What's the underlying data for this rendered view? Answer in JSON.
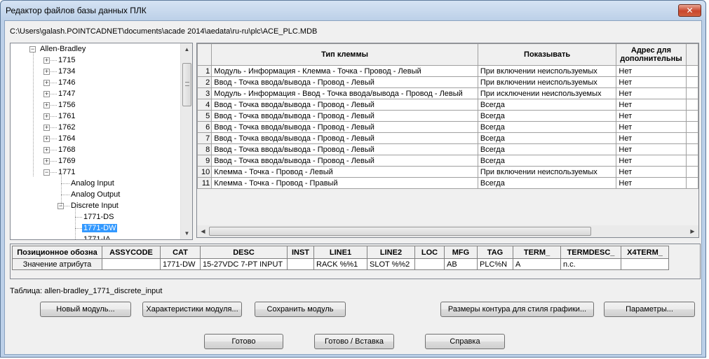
{
  "window": {
    "title": "Редактор файлов базы данных ПЛК",
    "close_label": "✕"
  },
  "path": "C:\\Users\\galash.POINTCADNET\\documents\\acade 2014\\aedata\\ru-ru\\plc\\ACE_PLC.MDB",
  "tree": {
    "root": "Allen-Bradley",
    "items": [
      {
        "label": "1715",
        "toggle": "+"
      },
      {
        "label": "1734",
        "toggle": "+"
      },
      {
        "label": "1746",
        "toggle": "+"
      },
      {
        "label": "1747",
        "toggle": "+"
      },
      {
        "label": "1756",
        "toggle": "+"
      },
      {
        "label": "1761",
        "toggle": "+"
      },
      {
        "label": "1762",
        "toggle": "+"
      },
      {
        "label": "1764",
        "toggle": "+"
      },
      {
        "label": "1768",
        "toggle": "+"
      },
      {
        "label": "1769",
        "toggle": "+"
      },
      {
        "label": "1771",
        "toggle": "−"
      }
    ],
    "sub": [
      "Analog Input",
      "Analog Output",
      "Discrete Input"
    ],
    "leaves": [
      "1771-DS",
      "1771-DW",
      "1771-IA"
    ],
    "selected": "1771-DW"
  },
  "grid": {
    "headers": [
      "Тип клеммы",
      "Показывать",
      "Адрес для дополнительны"
    ],
    "rows": [
      [
        "1",
        "Модуль - Информация - Клемма - Точка - Провод - Левый",
        "При включении неиспользуемых",
        "Нет"
      ],
      [
        "2",
        "Ввод - Точка ввода/вывода - Провод - Левый",
        "При включении неиспользуемых",
        "Нет"
      ],
      [
        "3",
        "Модуль - Информация - Ввод - Точка ввода/вывода - Провод - Левый",
        "При исключении неиспользуемых",
        "Нет"
      ],
      [
        "4",
        "Ввод - Точка ввода/вывода - Провод - Левый",
        "Всегда",
        "Нет"
      ],
      [
        "5",
        "Ввод - Точка ввода/вывода - Провод - Левый",
        "Всегда",
        "Нет"
      ],
      [
        "6",
        "Ввод - Точка ввода/вывода - Провод - Левый",
        "Всегда",
        "Нет"
      ],
      [
        "7",
        "Ввод - Точка ввода/вывода - Провод - Левый",
        "Всегда",
        "Нет"
      ],
      [
        "8",
        "Ввод - Точка ввода/вывода - Провод - Левый",
        "Всегда",
        "Нет"
      ],
      [
        "9",
        "Ввод - Точка ввода/вывода - Провод - Левый",
        "Всегда",
        "Нет"
      ],
      [
        "10",
        "Клемма - Точка - Провод - Левый",
        "При включении неиспользуемых",
        "Нет"
      ],
      [
        "11",
        "Клемма - Точка - Провод - Правый",
        "Всегда",
        "Нет"
      ]
    ]
  },
  "attributes": {
    "headers": [
      "Позиционное обозна",
      "ASSYCODE",
      "CAT",
      "DESC",
      "INST",
      "LINE1",
      "LINE2",
      "LOC",
      "MFG",
      "TAG",
      "TERM_",
      "TERMDESC_",
      "X4TERM_"
    ],
    "values": [
      "Значение атрибута",
      "",
      "1771-DW",
      "15-27VDC 7-PT INPUT",
      "",
      "RACK %%1",
      "SLOT %%2",
      "",
      "AB",
      "PLC%N",
      "A",
      "n.c.",
      ""
    ]
  },
  "table_name": "Таблица: allen-bradley_1771_discrete_input",
  "buttons": {
    "new_module": "Новый модуль...",
    "module_props": "Характеристики модуля...",
    "save_module": "Сохранить модуль",
    "outline_sizes": "Размеры контура для стиля графики...",
    "parameters": "Параметры...",
    "done": "Готово",
    "done_insert": "Готово / Вставка",
    "help": "Справка"
  }
}
